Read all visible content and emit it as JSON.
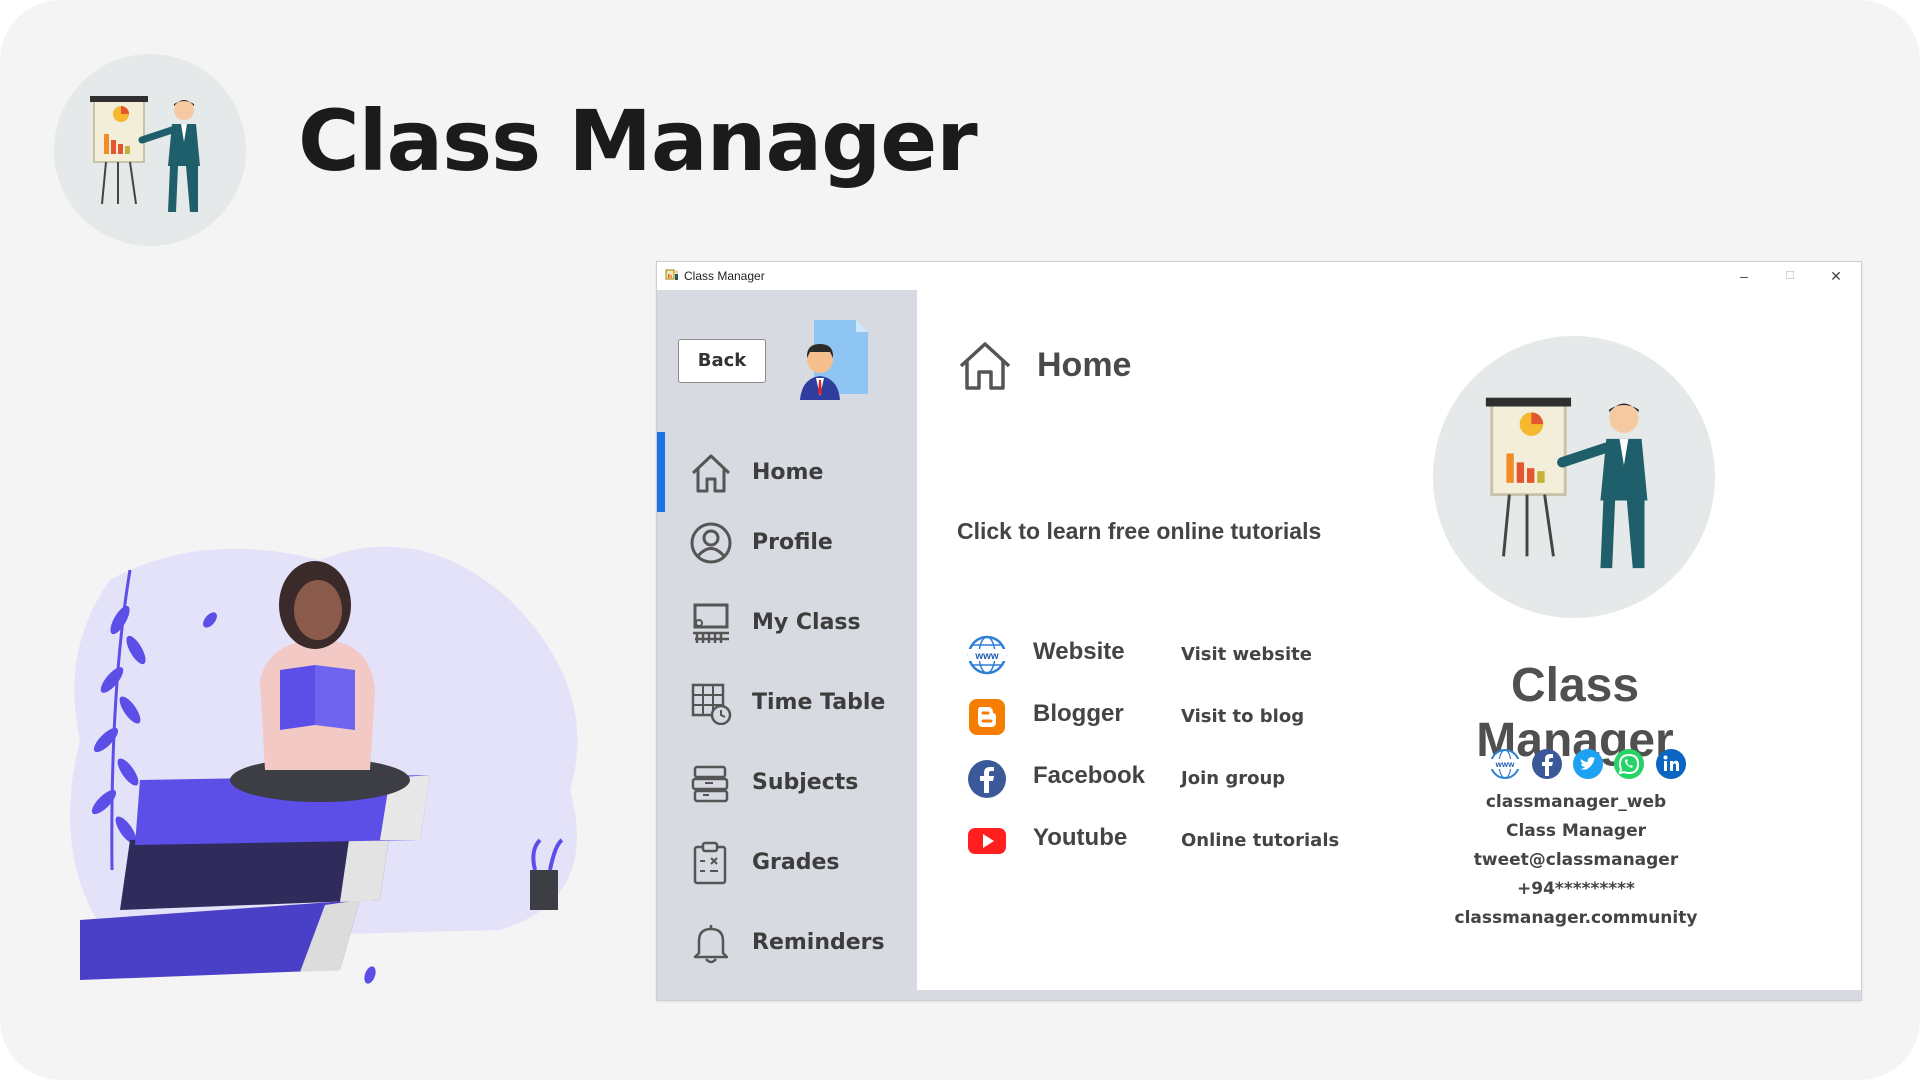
{
  "hero": {
    "title": "Class Manager"
  },
  "window": {
    "title": "Class Manager",
    "controls": {
      "minimize": "–",
      "maximize": "☐",
      "close": "✕"
    }
  },
  "sidebar": {
    "back_label": "Back",
    "items": [
      {
        "label": "Home",
        "icon": "home-icon",
        "active": true
      },
      {
        "label": "Profile",
        "icon": "profile-icon"
      },
      {
        "label": "My Class",
        "icon": "classroom-icon"
      },
      {
        "label": "Time Table",
        "icon": "timetable-icon"
      },
      {
        "label": "Subjects",
        "icon": "books-icon"
      },
      {
        "label": "Grades",
        "icon": "clipboard-icon"
      },
      {
        "label": "Reminders",
        "icon": "bell-icon"
      }
    ]
  },
  "main": {
    "title": "Home",
    "tutorial_prompt": "Click to learn free online tutorials",
    "links": [
      {
        "name": "Website",
        "action": "Visit website",
        "icon": "globe-icon",
        "color": "#2f7fd6"
      },
      {
        "name": "Blogger",
        "action": "Visit to blog",
        "icon": "blogger-icon",
        "color": "#f57d00"
      },
      {
        "name": "Facebook",
        "action": "Join group",
        "icon": "facebook-icon",
        "color": "#3b5998"
      },
      {
        "name": "Youtube",
        "action": "Online tutorials",
        "icon": "youtube-icon",
        "color": "#ff1f1f"
      }
    ]
  },
  "brand": {
    "name": "Class Manager",
    "social_icons": [
      "www-icon",
      "facebook-icon",
      "twitter-icon",
      "whatsapp-icon",
      "linkedin-icon"
    ],
    "contacts": [
      "classmanager_web",
      "Class Manager",
      "tweet@classmanager",
      "+94*********",
      "classmanager.community"
    ]
  },
  "colors": {
    "accent": "#1a73e8",
    "sidebar_bg": "#d8dae1",
    "card_bg": "#f4f4f4",
    "illustration_purple": "#5b4fe8"
  }
}
